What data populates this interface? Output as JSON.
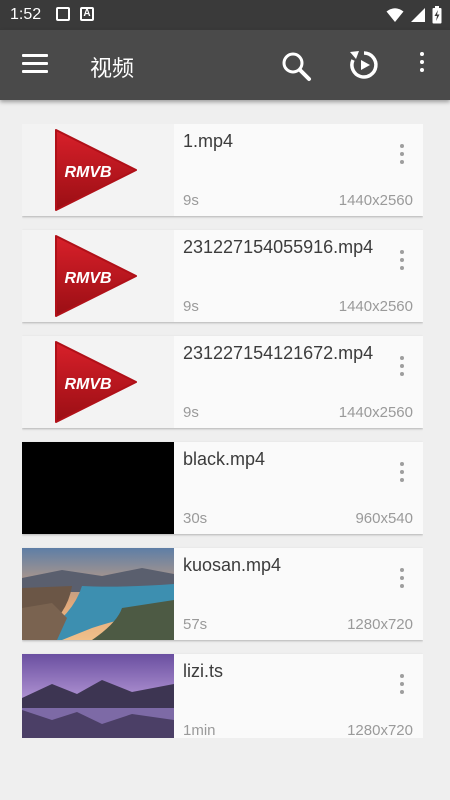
{
  "status_bar": {
    "time": "1:52",
    "icons": [
      "image-icon",
      "a-icon",
      "wifi-icon",
      "signal-icon",
      "battery-charging-icon"
    ]
  },
  "toolbar": {
    "title": "视频",
    "actions": [
      "menu-icon",
      "search-icon",
      "refresh-icon",
      "more-vert-icon"
    ]
  },
  "colors": {
    "toolbar": "#4a4a4a",
    "status_bar": "#3a3a3a",
    "background": "#efefef",
    "card": "#fafafa",
    "rmvb_red": "#c0141c"
  },
  "rmvb_label": "RMVB",
  "videos": [
    {
      "name": "1.mp4",
      "duration": "9s",
      "resolution": "1440x2560",
      "thumb": "rmvb"
    },
    {
      "name": "231227154055916.mp4",
      "duration": "9s",
      "resolution": "1440x2560",
      "thumb": "rmvb"
    },
    {
      "name": "231227154121672.mp4",
      "duration": "9s",
      "resolution": "1440x2560",
      "thumb": "rmvb"
    },
    {
      "name": "black.mp4",
      "duration": "30s",
      "resolution": "960x540",
      "thumb": "black"
    },
    {
      "name": "kuosan.mp4",
      "duration": "57s",
      "resolution": "1280x720",
      "thumb": "landscape-fjord"
    },
    {
      "name": "lizi.ts",
      "duration": "1min",
      "resolution": "1280x720",
      "thumb": "landscape-purple"
    }
  ]
}
